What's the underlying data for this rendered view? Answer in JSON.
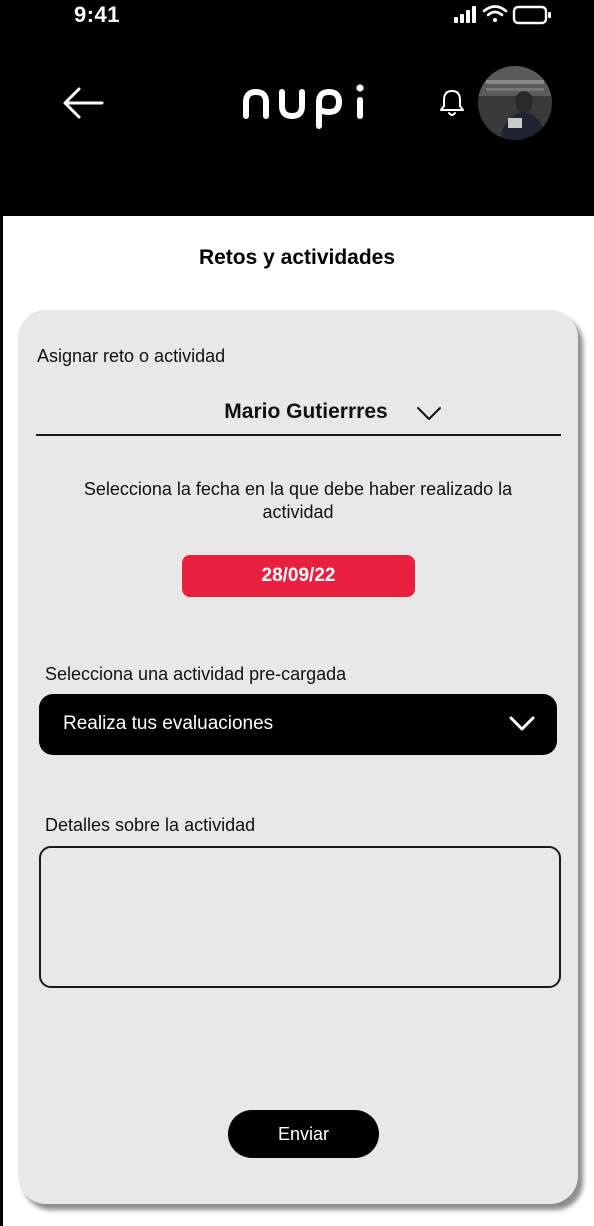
{
  "status_bar": {
    "time": "9:41",
    "icons": [
      "signal-icon",
      "wifi-icon",
      "battery-icon"
    ]
  },
  "header": {
    "logo_text": "nupi",
    "back_icon": "arrow-left-icon",
    "notification_icon": "bell-icon",
    "avatar_icon": "user-avatar"
  },
  "page": {
    "title": "Retos y actividades"
  },
  "form": {
    "assign_label": "Asignar reto o actividad",
    "student_selected": "Mario Gutierrres",
    "date_instruction": "Selecciona la fecha en la que debe haber realizado la actividad",
    "date_value": "28/09/22",
    "preloaded_label": "Selecciona una actividad pre-cargada",
    "preloaded_selected": "Realiza tus evaluaciones",
    "details_label": "Detalles sobre la actividad",
    "details_value": "",
    "submit_label": "Enviar"
  },
  "colors": {
    "header_bg": "#000000",
    "card_bg": "#e8e8e8",
    "accent_red": "#e8203f",
    "dark_button": "#000000"
  }
}
